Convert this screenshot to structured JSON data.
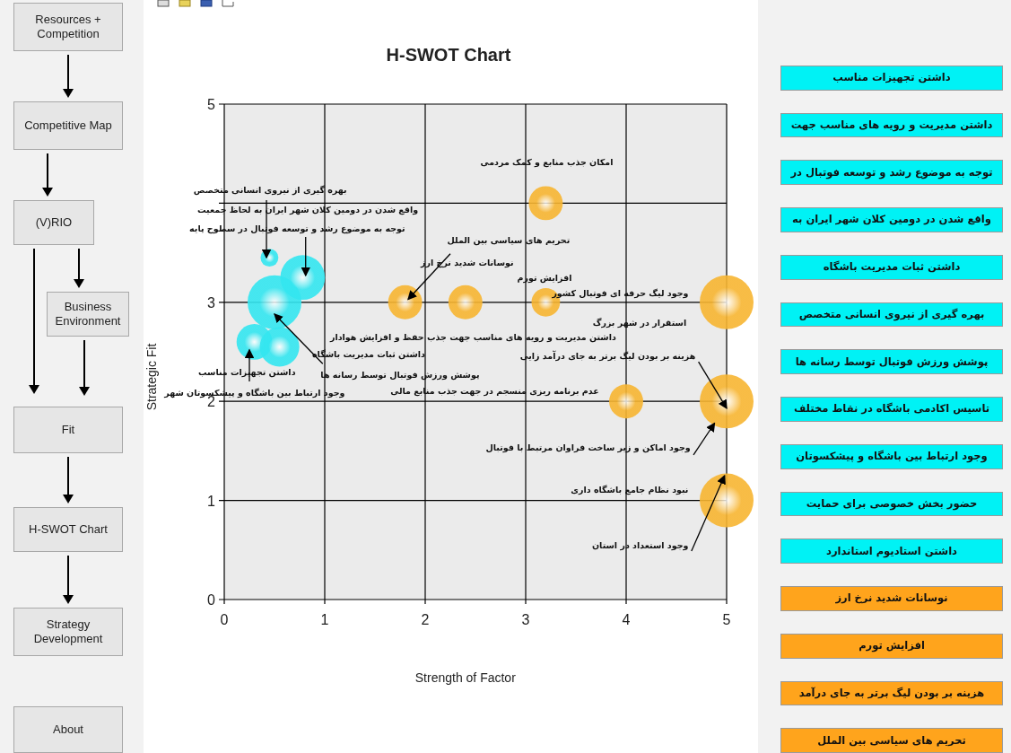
{
  "sidebar": {
    "items": [
      {
        "label": "Resources + Competition"
      },
      {
        "label": "Competitive Map"
      },
      {
        "label": "(V)RIO"
      },
      {
        "label": "Business Environment"
      },
      {
        "label": "Fit"
      },
      {
        "label": "H-SWOT Chart"
      },
      {
        "label": "Strategy Development"
      },
      {
        "label": "About"
      }
    ]
  },
  "chart": {
    "chart_data": {
      "type": "scatter",
      "title": "H-SWOT Chart",
      "xlabel": "Strength of Factor",
      "ylabel": "Strategic Fit",
      "xlim": [
        0,
        5
      ],
      "ylim": [
        0,
        5
      ],
      "xticks": [
        0,
        1,
        2,
        3,
        4,
        5
      ],
      "yticks": [
        0,
        1,
        2,
        3,
        5
      ],
      "grid": true,
      "series": [
        {
          "color": "#33e6f0",
          "x": [
            0.45,
            0.5,
            0.78,
            0.3,
            0.55
          ],
          "values": [
            3.45,
            3.0,
            3.25,
            2.6,
            2.55
          ],
          "sizes": [
            0.11,
            1,
            0.69,
            0.44,
            0.54
          ]
        },
        {
          "color": "#f7b531",
          "x": [
            3.2,
            1.8,
            2.4,
            3.2,
            5,
            4,
            5,
            5
          ],
          "values": [
            4.0,
            3.0,
            3.0,
            3.0,
            3.0,
            2.0,
            2.0,
            1.0
          ],
          "sizes": [
            0.4,
            0.4,
            0.4,
            0.28,
            1,
            0.4,
            1,
            1
          ]
        }
      ],
      "annotations": [
        "امکان جذب منابع و کمک مردمی",
        "بهره گیری از نیروی انسانی متخصص",
        "واقع شدن در دومین کلان شهر ایران به لحاظ جمعیت",
        "توجه به موضوع رشد و توسعه فوتبال در سطوح پایه",
        "تحریم های سیاسی بین الملل",
        "نوسانات شدید نرخ ارز",
        "افزایش تورم",
        "وجود لیگ حرفه ای فوتبال کشور",
        "استقرار در شهر بزرگ",
        "داشتن مدیریت و رویه های مناسب جهت جذب حفظ و افزایش هوادار",
        "هزینه بر بودن لیگ برتر به جای درآمد زایی",
        "داشتن ثبات مدیریت باشگاه",
        "پوشش ورزش فوتبال توسط رسانه ها",
        "داشتن تجهیزات مناسب",
        "عدم برنامه ریزی منسجم در جهت جذب منابع مالی",
        "وجود ارتباط بین باشگاه و پیشکسوتان شهر",
        "وجود اماکن و زیر ساخت فراوان مرتبط با فوتبال",
        "نبود نظام جامع باشگاه داری",
        "وجود استعداد در استان"
      ]
    }
  },
  "factors": [
    {
      "label": "داشتن تجهیزات مناسب",
      "color": "#00f2f5"
    },
    {
      "label": "داشتن مدیریت و رویه های مناسب جهت",
      "color": "#00f2f5"
    },
    {
      "label": "توجه به موضوع رشد و توسعه فوتبال در",
      "color": "#00f2f5"
    },
    {
      "label": "واقع شدن در دومین کلان شهر ایران به",
      "color": "#00f2f5"
    },
    {
      "label": "داشتن ثبات مدیریت باشگاه",
      "color": "#00f2f5"
    },
    {
      "label": "بهره گیری از نیروی انسانی متخصص",
      "color": "#00f2f5"
    },
    {
      "label": "پوشش ورزش فوتبال توسط رسانه ها",
      "color": "#00f2f5"
    },
    {
      "label": "تاسیس اکادمی باشگاه در نقاط مختلف",
      "color": "#00f2f5"
    },
    {
      "label": "وجود ارتباط بین باشگاه و پیشکسوتان",
      "color": "#00f2f5"
    },
    {
      "label": "حضور بخش خصوصی برای حمایت",
      "color": "#00f2f5"
    },
    {
      "label": "داشتن استادیوم استاندارد",
      "color": "#00f2f5"
    },
    {
      "label": "نوسانات شدید نرخ ارز",
      "color": "#ffa41c"
    },
    {
      "label": "افزایش تورم",
      "color": "#ffa41c"
    },
    {
      "label": "هزینه بر بودن لیگ برتر به جای درآمد",
      "color": "#ffa41c"
    },
    {
      "label": "تحریم های سیاسی بین الملل",
      "color": "#ffa41c"
    }
  ]
}
